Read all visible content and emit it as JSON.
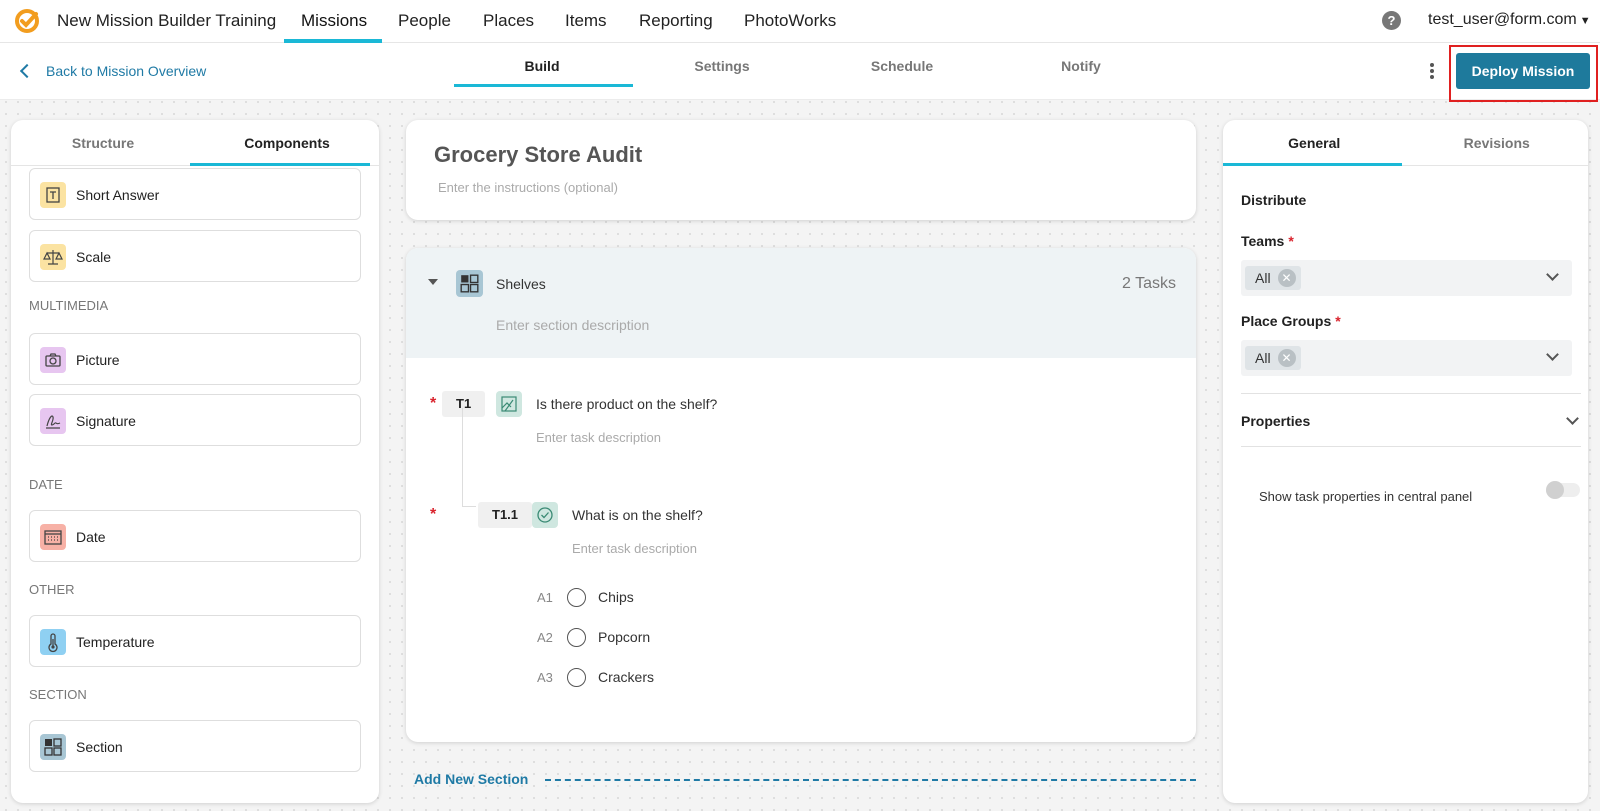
{
  "app": {
    "title": "New Mission Builder Training"
  },
  "nav": {
    "items": [
      "Missions",
      "People",
      "Places",
      "Items",
      "Reporting",
      "PhotoWorks"
    ],
    "active": "Missions"
  },
  "user": {
    "email": "test_user@form.com",
    "help": "?"
  },
  "subheader": {
    "back_label": "Back to Mission Overview",
    "steps": [
      "Build",
      "Settings",
      "Schedule",
      "Notify"
    ],
    "active_step": "Build",
    "deploy_label": "Deploy Mission"
  },
  "left_panel": {
    "tabs": [
      "Structure",
      "Components"
    ],
    "active_tab": "Components",
    "components": {
      "short_answer": "Short Answer",
      "scale": "Scale",
      "multimedia_heading": "MULTIMEDIA",
      "picture": "Picture",
      "signature": "Signature",
      "date_heading": "DATE",
      "date": "Date",
      "other_heading": "OTHER",
      "temperature": "Temperature",
      "section_heading": "SECTION",
      "section": "Section"
    }
  },
  "mission": {
    "title": "Grocery Store Audit",
    "instructions_placeholder": "Enter the instructions (optional)"
  },
  "section": {
    "name": "Shelves",
    "count": "2 Tasks",
    "description_placeholder": "Enter section description",
    "tasks": [
      {
        "number": "T1",
        "question": "Is there product on the shelf?",
        "description_placeholder": "Enter task description"
      },
      {
        "number": "T1.1",
        "question": "What is on the shelf?",
        "description_placeholder": "Enter task description"
      }
    ],
    "answers": [
      {
        "label": "A1",
        "text": "Chips"
      },
      {
        "label": "A2",
        "text": "Popcorn"
      },
      {
        "label": "A3",
        "text": "Crackers"
      }
    ],
    "add_new_section": "Add New Section"
  },
  "right_panel": {
    "tabs": [
      "General",
      "Revisions"
    ],
    "active_tab": "General",
    "distribute": "Distribute",
    "teams_label": "Teams",
    "teams_value": "All",
    "place_groups_label": "Place Groups",
    "place_groups_value": "All",
    "required_mark": "*",
    "properties": "Properties",
    "toggle_label": "Show task properties in central panel"
  },
  "colors": {
    "accent": "#1ab8d6",
    "primary_button": "#1e7a9c",
    "link": "#1f7aa5",
    "required": "#d9232d",
    "highlight_outline": "#e02020"
  },
  "icons": {
    "logo": "form-logo-check-icon",
    "help": "question-circle-icon",
    "back": "chevron-left-icon",
    "more": "kebab-menu-icon"
  }
}
